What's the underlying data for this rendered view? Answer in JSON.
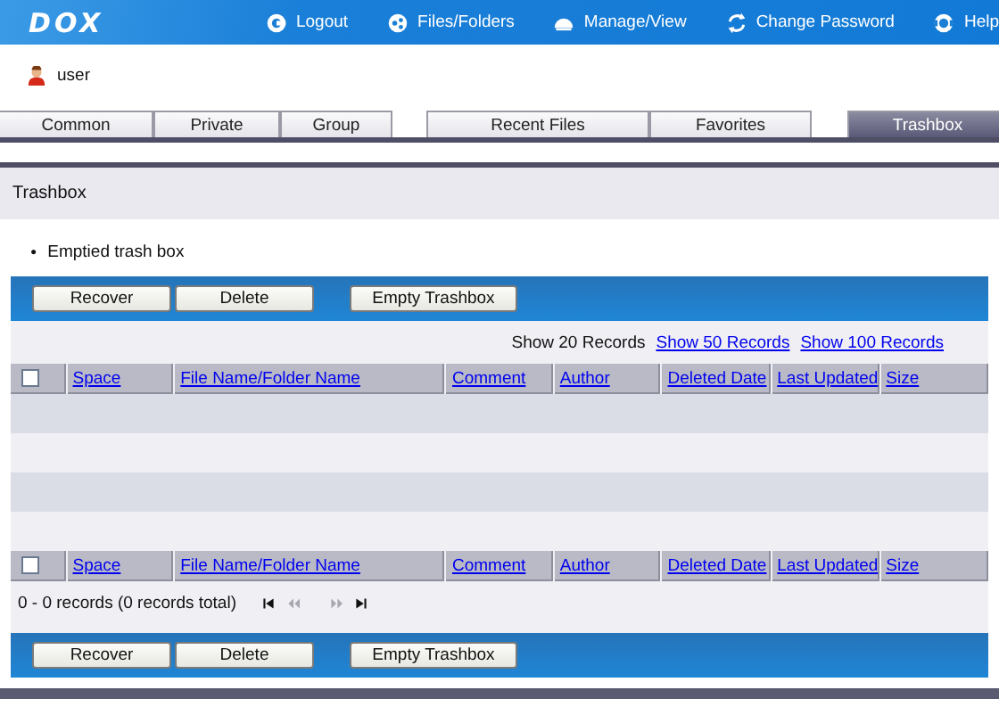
{
  "header": {
    "logo": "DOX",
    "nav": [
      {
        "label": "Logout"
      },
      {
        "label": "Files/Folders"
      },
      {
        "label": "Manage/View"
      },
      {
        "label": "Change Password"
      },
      {
        "label": "Help"
      }
    ]
  },
  "user": {
    "name": "user"
  },
  "tab_groups": [
    [
      {
        "label": "Common",
        "selected": false
      },
      {
        "label": "Private",
        "selected": false
      },
      {
        "label": "Group",
        "selected": false
      }
    ],
    [
      {
        "label": "Recent Files",
        "selected": false
      },
      {
        "label": "Favorites",
        "selected": false
      }
    ],
    [
      {
        "label": "Trashbox",
        "selected": true
      }
    ]
  ],
  "section_title": "Trashbox",
  "messages": [
    {
      "bullet": "●",
      "text": "Emptied trash box"
    }
  ],
  "toolbar_top": [
    "Recover",
    "Delete",
    "Empty Trashbox"
  ],
  "records_bar": {
    "current": "Show 20 Records",
    "links": [
      "Show 50 Records",
      "Show 100 Records"
    ]
  },
  "table": {
    "select_all_checked": false,
    "columns": [
      "Space",
      "File Name/Folder Name",
      "Comment",
      "Author",
      "Deleted Date",
      "Last Updated",
      "Size"
    ]
  },
  "table_footer": {
    "select_all_checked": false,
    "columns": [
      "Space",
      "File Name/Folder Name",
      "Comment",
      "Author",
      "Deleted Date",
      "Last Updated",
      "Size"
    ]
  },
  "pager": {
    "summary": "0 - 0 records (0 records total)",
    "controls": [
      {
        "kind": "first",
        "disabled": false
      },
      {
        "kind": "prev",
        "disabled": true
      },
      {
        "kind": "next",
        "disabled": true
      },
      {
        "kind": "last",
        "disabled": false
      }
    ]
  },
  "toolbar_bottom": [
    "Recover",
    "Delete",
    "Empty Trashbox"
  ]
}
